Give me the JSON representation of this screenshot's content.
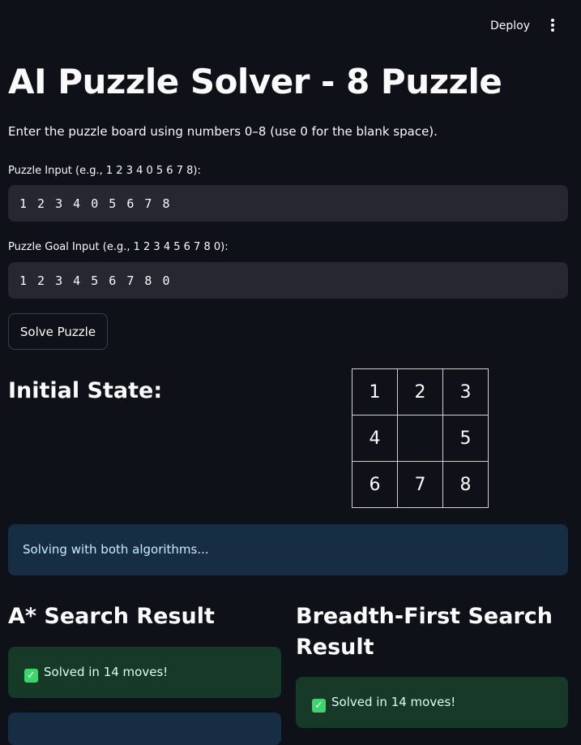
{
  "header": {
    "deploy_label": "Deploy"
  },
  "title": "AI Puzzle Solver - 8 Puzzle",
  "intro": "Enter the puzzle board using numbers 0–8 (use 0 for the blank space).",
  "inputs": {
    "puzzle_label": "Puzzle Input (e.g., 1 2 3 4 0 5 6 7 8):",
    "puzzle_value": "1 2 3 4 0 5 6 7 8",
    "goal_label": "Puzzle Goal Input (e.g., 1 2 3 4 5 6 7 8 0):",
    "goal_value": "1 2 3 4 5 6 7 8 0"
  },
  "solve_button": "Solve Puzzle",
  "initial_state": {
    "heading": "Initial State:",
    "cells": [
      "1",
      "2",
      "3",
      "4",
      "",
      "5",
      "6",
      "7",
      "8"
    ]
  },
  "status_info": "Solving with both algorithms...",
  "results": {
    "astar": {
      "heading": "A* Search Result",
      "message": "Solved in 14 moves!"
    },
    "bfs": {
      "heading_line1": "Breadth-First Search",
      "heading_line2": "Result",
      "message": "Solved in 14 moves!"
    }
  },
  "icons": {
    "check": "white-check-mark-icon",
    "menu": "kebab-menu-icon"
  },
  "colors": {
    "background": "#0e1117",
    "input_bg": "#262730",
    "info_bg": "#172d43",
    "success_bg": "#173928",
    "check_green": "#3dd56d"
  }
}
